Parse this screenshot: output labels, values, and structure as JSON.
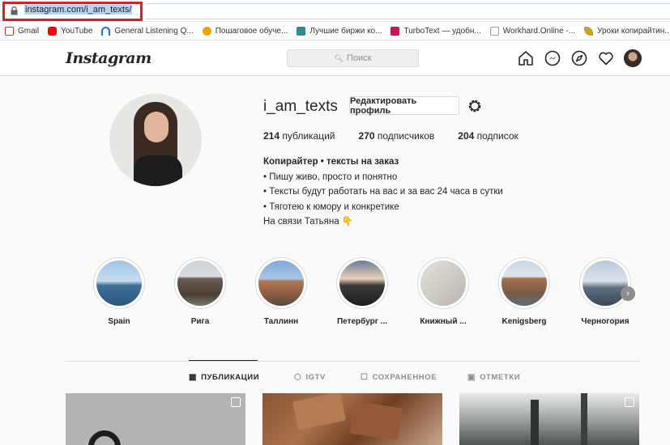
{
  "browser": {
    "url": "instagram.com/i_am_texts/",
    "bookmarks": [
      {
        "label": "Gmail",
        "icon": "gmail-icon",
        "color": "#d93025"
      },
      {
        "label": "YouTube",
        "icon": "youtube-icon",
        "color": "#ff0000"
      },
      {
        "label": "General Listening Q...",
        "icon": "headphones-icon",
        "color": "#1a73e8"
      },
      {
        "label": "Пошаговое обуче...",
        "icon": "bulb-icon",
        "color": "#f2a007"
      },
      {
        "label": "Лучшие биржи ко...",
        "icon": "site-icon",
        "color": "#2a8c8c"
      },
      {
        "label": "TurboText — удобн...",
        "icon": "turbotext-icon",
        "color": "#c2185b"
      },
      {
        "label": "Workhard.Online -...",
        "icon": "page-icon",
        "color": "#9e9e9e"
      },
      {
        "label": "Уроки копирайтин...",
        "icon": "feather-icon",
        "color": "#c9a227"
      }
    ]
  },
  "header": {
    "logo": "Instagram",
    "search_placeholder": "Поиск"
  },
  "profile": {
    "username": "i_am_texts",
    "edit_button": "Редактировать профиль",
    "stats": {
      "posts_count": "214",
      "posts_label": "публикаций",
      "followers_count": "270",
      "followers_label": "подписчиков",
      "following_count": "204",
      "following_label": "подписок"
    },
    "bio": {
      "line1": "Копирайтер • тексты на заказ",
      "line2": "• Пишу живо, просто и понятно",
      "line3": "• Тексты будут работать на вас и за вас 24 часа в сутки",
      "line4": "• Тяготею к юмору и конкретике",
      "line5": "На связи Татьяна 👇"
    }
  },
  "highlights": [
    {
      "label": "Spain"
    },
    {
      "label": "Рига"
    },
    {
      "label": "Таллинн"
    },
    {
      "label": "Петербург ..."
    },
    {
      "label": "Книжный ..."
    },
    {
      "label": "Kenigsberg"
    },
    {
      "label": "Черногория"
    }
  ],
  "tabs": [
    {
      "label": "ПУБЛИКАЦИИ",
      "icon": "grid-icon",
      "active": true
    },
    {
      "label": "IGTV",
      "icon": "igtv-icon",
      "active": false
    },
    {
      "label": "СОХРАНЕННОЕ",
      "icon": "bookmark-icon",
      "active": false
    },
    {
      "label": "ОТМЕТКИ",
      "icon": "tag-icon",
      "active": false
    }
  ],
  "colors": {
    "highlight_border": "#d8202c",
    "text": "#262626",
    "muted": "#8e8e8e"
  }
}
